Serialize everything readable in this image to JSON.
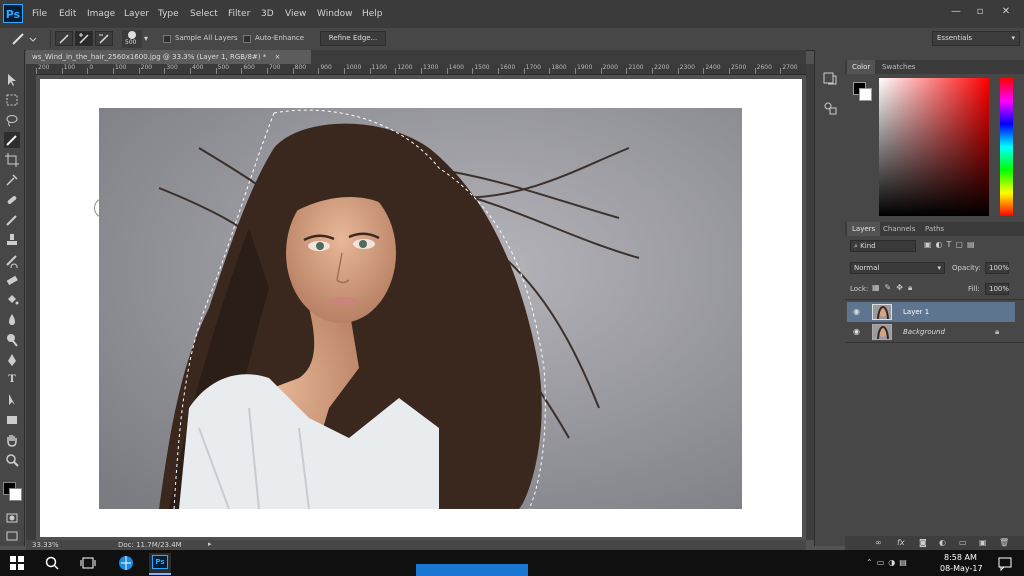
{
  "app": {
    "logo": "Ps",
    "accent": "#31a8ff"
  },
  "menu": [
    "File",
    "Edit",
    "Image",
    "Layer",
    "Type",
    "Select",
    "Filter",
    "3D",
    "View",
    "Window",
    "Help"
  ],
  "window_controls": {
    "minimize": "—",
    "restore": "▫",
    "close": "✕"
  },
  "options_bar": {
    "brush_size": "500",
    "sample_all_layers": "Sample All Layers",
    "auto_enhance": "Auto-Enhance",
    "refine_edge": "Refine Edge...",
    "workspace": "Essentials"
  },
  "document": {
    "tab_title": "ws_Wind_in_the_hair_2560x1600.jpg @ 33.3% (Layer 1, RGB/8#) *",
    "tab_close": "×",
    "ruler_ticks": [
      "200",
      "100",
      "0",
      "100",
      "200",
      "300",
      "400",
      "500",
      "600",
      "700",
      "800",
      "900",
      "1000",
      "1100",
      "1200",
      "1300",
      "1400",
      "1500",
      "1600",
      "1700",
      "1800",
      "1900",
      "2000",
      "2100",
      "2200",
      "2300",
      "2400",
      "2500",
      "2600",
      "2700"
    ],
    "zoom": "33.33%",
    "doc_size": "Doc: 11.7M/23.4M"
  },
  "panels": {
    "color_tabs": [
      "Color",
      "Swatches"
    ],
    "layers_tabs": [
      "Layers",
      "Channels",
      "Paths"
    ],
    "filter_kind": "Kind",
    "blend_mode": "Normal",
    "opacity_label": "Opacity:",
    "opacity_value": "100%",
    "lock_label": "Lock:",
    "fill_label": "Fill:",
    "fill_value": "100%",
    "layers": [
      {
        "name": "Layer 1",
        "selected": true
      },
      {
        "name": "Background",
        "selected": false
      }
    ],
    "footer_icons": [
      "link-icon",
      "fx-icon",
      "mask-icon",
      "adjustment-icon",
      "group-icon",
      "new-layer-icon",
      "trash-icon"
    ]
  },
  "taskbar": {
    "time": "8:58 AM",
    "date": "08-May-17"
  }
}
